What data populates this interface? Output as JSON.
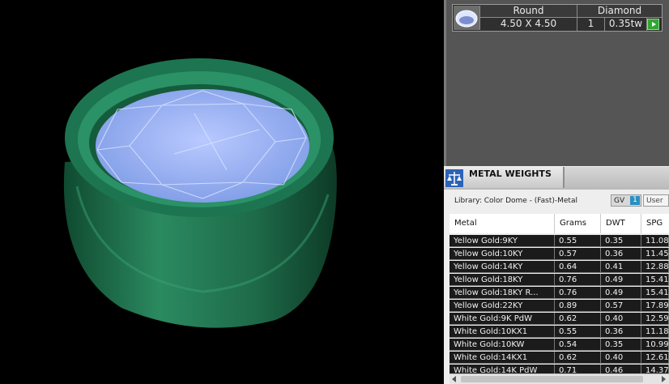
{
  "stone": {
    "shape": "Round",
    "type": "Diamond",
    "size": "4.50 X 4.50",
    "quantity": "1",
    "weight": "0.35tw",
    "thumb_icon": "round-diamond-icon",
    "go_icon": "play-arrow-icon"
  },
  "metal_weights": {
    "title": "METAL WEIGHTS",
    "icon": "weight-scale-icon",
    "library": "Library: Color Dome - (Fast)-Metal",
    "gv_label": "GV",
    "gv_count": "1",
    "user_label": "User",
    "columns": [
      "Metal",
      "Grams",
      "DWT",
      "SPG"
    ],
    "rows": [
      [
        "Yellow Gold:9KY",
        "0.55",
        "0.35",
        "11.08"
      ],
      [
        "Yellow Gold:10KY",
        "0.57",
        "0.36",
        "11.45"
      ],
      [
        "Yellow Gold:14KY",
        "0.64",
        "0.41",
        "12.88"
      ],
      [
        "Yellow Gold:18KY",
        "0.76",
        "0.49",
        "15.41"
      ],
      [
        "Yellow Gold:18KY R...",
        "0.76",
        "0.49",
        "15.41"
      ],
      [
        "Yellow Gold:22KY",
        "0.89",
        "0.57",
        "17.89"
      ],
      [
        "White Gold:9K PdW",
        "0.62",
        "0.40",
        "12.59"
      ],
      [
        "White Gold:10KX1",
        "0.55",
        "0.36",
        "11.18"
      ],
      [
        "White Gold:10KW",
        "0.54",
        "0.35",
        "10.99"
      ],
      [
        "White Gold:14KX1",
        "0.62",
        "0.40",
        "12.61"
      ],
      [
        "White Gold:14K PdW",
        "0.71",
        "0.46",
        "14.37"
      ]
    ]
  },
  "viewport": {
    "subject": "green ring with round diamond wireframe",
    "colors": {
      "metal": "#1f6f4d",
      "stone": "#8fb0ff"
    }
  }
}
